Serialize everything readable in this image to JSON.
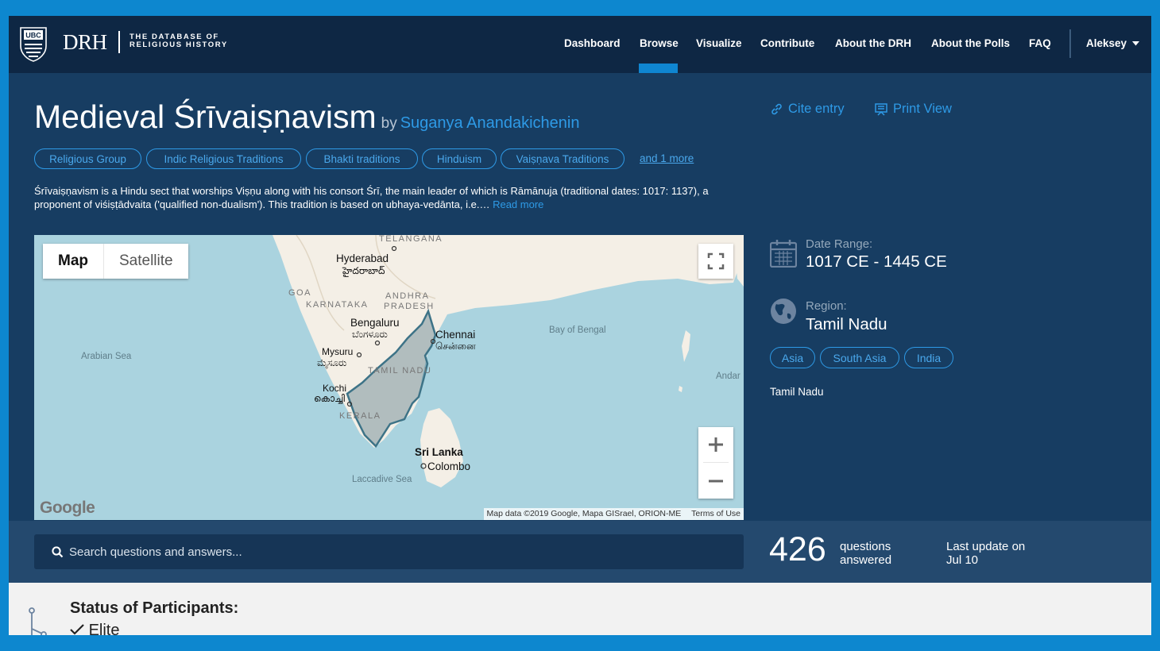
{
  "brand": {
    "logo_text": "UBC",
    "name": "DRH",
    "subtitle_line1": "THE DATABASE OF",
    "subtitle_line2": "RELIGIOUS HISTORY"
  },
  "nav": {
    "items": [
      {
        "label": "Dashboard"
      },
      {
        "label": "Browse",
        "active": true
      },
      {
        "label": "Visualize"
      },
      {
        "label": "Contribute"
      },
      {
        "label": "About the DRH"
      },
      {
        "label": "About the Polls"
      },
      {
        "label": "FAQ"
      }
    ],
    "user": "Aleksey"
  },
  "entry": {
    "title": "Medieval Śrīvaiṣṇavism",
    "by": "by",
    "author": "Suganya Anandakichenin",
    "cite_label": "Cite entry",
    "print_label": "Print View",
    "tags": [
      "Religious Group",
      "Indic Religious Traditions",
      "Bhakti traditions",
      "Hinduism",
      "Vaiṣṇava Traditions"
    ],
    "more_tags": "and 1 more",
    "description": "Śrīvaiṣṇavism is a Hindu sect that worships Viṣṇu along with his consort Śrī, the main leader of which is Rāmānuja (traditional dates: 1017: 1137), a proponent of viśiṣṭādvaita ('qualified non-dualism'). This tradition is based on ubhaya-vedānta, i.e.…",
    "read_more": "Read more"
  },
  "map": {
    "type_map": "Map",
    "type_satellite": "Satellite",
    "labels": {
      "telangana": "TELANGANA",
      "hyderabad": "Hyderabad",
      "hyderabad_local": "హైదరాబాద్",
      "goa": "GOA",
      "karnataka": "KARNATAKA",
      "andhra": "ANDHRA",
      "pradesh": "PRADESH",
      "bengaluru": "Bengaluru",
      "bengaluru_local": "ಬೆಂಗಳೂರು",
      "chennai": "Chennai",
      "chennai_local": "சென்னை",
      "mysuru": "Mysuru",
      "mysuru_local": "ಮೈಸೂರು",
      "tamil_nadu": "TAMIL NADU",
      "kochi": "Kochi",
      "kochi_local": "കൊച്ചി",
      "kerala": "KERALA",
      "arabian_sea": "Arabian Sea",
      "bay_of_bengal": "Bay of Bengal",
      "sri_lanka": "Sri Lanka",
      "colombo": "Colombo",
      "laccadive_sea": "Laccadive Sea",
      "andaman": "Andar"
    },
    "google": "Google",
    "attribution": "Map data ©2019 Google, Mapa GISrael, ORION-ME",
    "terms": "Terms of Use"
  },
  "info": {
    "date_label": "Date Range:",
    "date_value": "1017 CE - 1445 CE",
    "region_label": "Region:",
    "region_value": "Tamil Nadu",
    "region_tags": [
      "Asia",
      "South Asia",
      "India"
    ],
    "region_note": "Tamil Nadu"
  },
  "stats": {
    "search_placeholder": "Search questions and answers...",
    "count": "426",
    "count_label1": "questions",
    "count_label2": "answered",
    "update_line1": "Last update on",
    "update_line2": "Jul 10"
  },
  "status": {
    "title": "Status of Participants:",
    "item": "Elite"
  },
  "colors": {
    "accent": "#2e9ae6",
    "nav_bg": "#0e2744",
    "page_bg": "#173d62",
    "outer_border": "#0d87cf"
  }
}
